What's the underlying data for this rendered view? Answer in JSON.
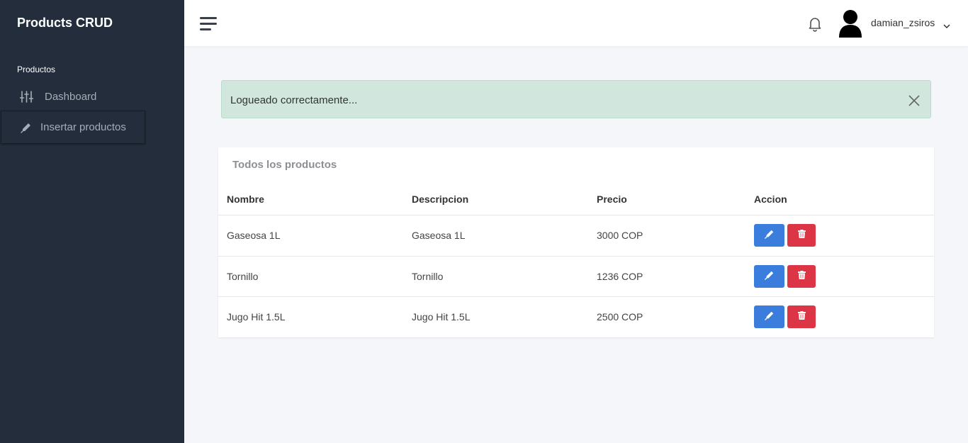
{
  "sidebar": {
    "brand": "Products CRUD",
    "section": "Productos",
    "items": [
      {
        "label": "Dashboard",
        "icon": "sliders-icon"
      },
      {
        "label": "Insertar productos",
        "icon": "pen-icon"
      }
    ]
  },
  "header": {
    "username": "damian_zsiros",
    "icons": [
      "hamburger-icon",
      "bell-icon",
      "user-avatar-icon",
      "chevron-down-icon"
    ]
  },
  "alert": {
    "message": "Logueado correctamente...",
    "close_icon": "close-icon"
  },
  "products_card": {
    "title": "Todos los productos",
    "columns": [
      "Nombre",
      "Descripcion",
      "Precio",
      "Accion"
    ],
    "rows": [
      {
        "nombre": "Gaseosa 1L",
        "descripcion": "Gaseosa 1L",
        "precio": "3000 COP"
      },
      {
        "nombre": "Tornillo",
        "descripcion": "Tornillo",
        "precio": "1236 COP"
      },
      {
        "nombre": "Jugo Hit 1.5L",
        "descripcion": "Jugo Hit 1.5L",
        "precio": "2500 COP"
      }
    ],
    "action_icons": [
      "pen-icon",
      "trash-icon"
    ]
  },
  "colors": {
    "sidebar_bg": "#232d3b",
    "page_bg": "#f4f6f9",
    "alert_bg": "#d1e7dd",
    "edit_button": "#3b7ddd",
    "delete_button": "#dc3545"
  }
}
